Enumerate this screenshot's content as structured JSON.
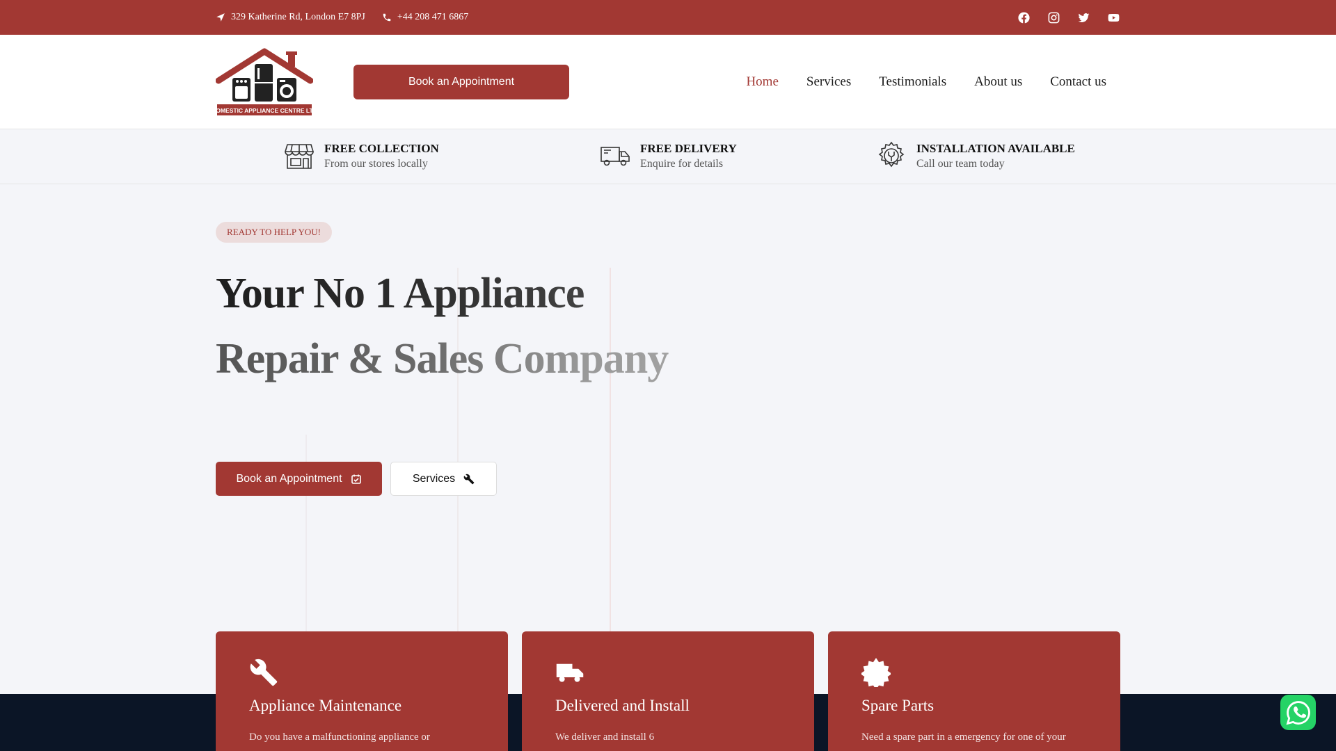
{
  "topbar": {
    "address": "329 Katherine Rd, London E7 8PJ",
    "phone": "+44 208 471 6867",
    "socials": [
      "facebook-icon",
      "instagram-icon",
      "twitter-icon",
      "youtube-icon"
    ]
  },
  "header": {
    "logo_text": "DOMESTIC APPLIANCE CENTRE LTD",
    "book_label": "Book an Appointment",
    "nav": [
      {
        "label": "Home",
        "active": true
      },
      {
        "label": "Services"
      },
      {
        "label": "Testimonials"
      },
      {
        "label": "About us"
      },
      {
        "label": "Contact us"
      }
    ]
  },
  "features": [
    {
      "title": "FREE COLLECTION",
      "sub": "From our stores locally",
      "icon": "store-icon"
    },
    {
      "title": "FREE DELIVERY",
      "sub": "Enquire for details",
      "icon": "truck-icon"
    },
    {
      "title": "INSTALLATION AVAILABLE",
      "sub": "Call our team today",
      "icon": "gear-wrench-icon"
    }
  ],
  "hero": {
    "badge": "READY TO HELP YOU!",
    "headline_line1": "Your No 1 Appliance",
    "headline_line2": "Repair & Sales Company",
    "primary_cta": "Book an Appointment",
    "secondary_cta": "Services"
  },
  "cards": [
    {
      "title": "Appliance Maintenance",
      "desc": "Do you have a malfunctioning appliance or",
      "icon": "wrench-icon"
    },
    {
      "title": "Delivered and Install",
      "desc": "We deliver and install 6",
      "icon": "truck-icon"
    },
    {
      "title": "Spare Parts",
      "desc": "Need a spare part in a emergency for one of your",
      "icon": "gear-icon"
    }
  ],
  "colors": {
    "brand": "#a23833",
    "dark": "#0b1526",
    "whatsapp": "#25d366"
  }
}
